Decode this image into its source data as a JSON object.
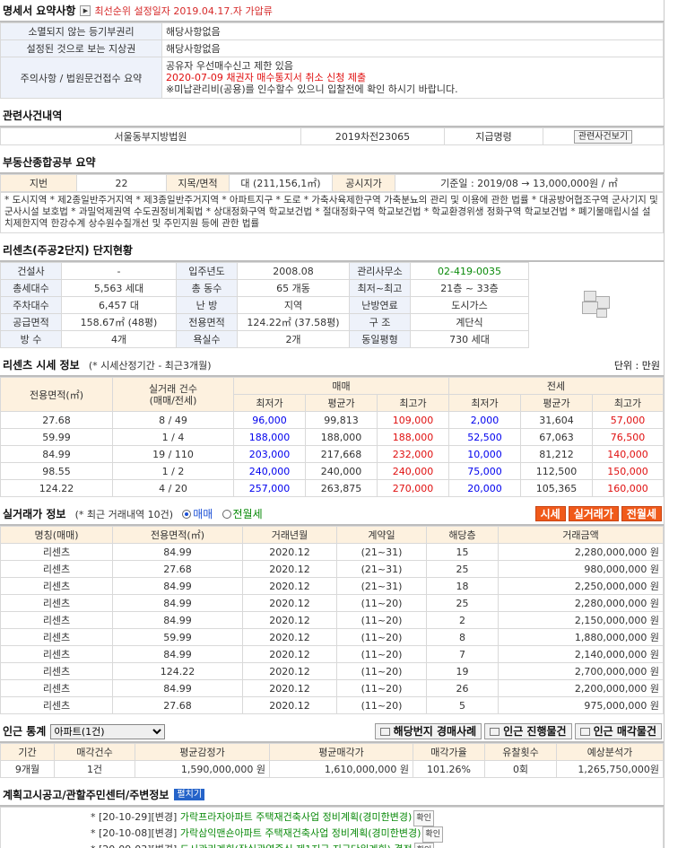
{
  "summary": {
    "title": "명세서 요약사항",
    "note": "최선순위 설정일자 2019.04.17.자 가압류",
    "rows": [
      {
        "label": "소멸되지 않는 등기부권리",
        "value": "해당사항없음"
      },
      {
        "label": "설정된 것으로 보는 지상권",
        "value": "해당사항없음"
      }
    ],
    "caution_label": "주의사항 / 법원문건접수 요약",
    "caution_line1": "공유자 우선매수신고 제한 있음",
    "caution_line2": "2020-07-09 채권자 매수통지서 취소 신청 제출",
    "caution_line3": "※미납관리비(공용)를 인수할수 있으니 입찰전에 확인 하시기 바랍니다."
  },
  "related": {
    "title": "관련사건내역",
    "court": "서울동부지방법원",
    "case_no": "2019차전23065",
    "type": "지급명령",
    "button": "관련사건보기"
  },
  "land": {
    "title": "부동산종합공부 요약",
    "lot_label": "지번",
    "lot_value": "22",
    "area_label": "지목/면적",
    "area_value": "대 (211,156,1㎡)",
    "price_label": "공시지가",
    "price_value": "기준일 : 2019/08 → 13,000,000원 / ㎡",
    "zoning": "* 도시지역 * 제2종일반주거지역 * 제3종일반주거지역 * 아파트지구 * 도로 * 가축사육제한구역 가축분뇨의 관리 및 이용에 관한 법률 * 대공방어협조구역 군사기지 및 군사시설 보호법 * 과밀억제권역 수도권정비계획법 * 상대정화구역 학교보건법 * 절대정화구역 학교보건법 * 학교환경위생 정화구역 학교보건법 * 폐기물매립시설 설치제한지역 한강수계 상수원수질개선 및 주민지원 등에 관한 법률"
  },
  "complex": {
    "title": "리센츠(주공2단지) 단지현황",
    "rows": [
      [
        {
          "l": "건설사",
          "v": "-"
        },
        {
          "l": "입주년도",
          "v": "2008.08"
        },
        {
          "l": "관리사무소",
          "v": "02-419-0035"
        }
      ],
      [
        {
          "l": "총세대수",
          "v": "5,563 세대"
        },
        {
          "l": "총 동수",
          "v": "65 개동"
        },
        {
          "l": "최저~최고",
          "v": "21층 ~ 33층"
        }
      ],
      [
        {
          "l": "주차대수",
          "v": "6,457 대"
        },
        {
          "l": "난 방",
          "v": "지역"
        },
        {
          "l": "난방연료",
          "v": "도시가스"
        }
      ],
      [
        {
          "l": "공급면적",
          "v": "158.67㎡ (48평)"
        },
        {
          "l": "전용면적",
          "v": "124.22㎡ (37.58평)"
        },
        {
          "l": "구 조",
          "v": "계단식"
        }
      ],
      [
        {
          "l": "방 수",
          "v": "4개"
        },
        {
          "l": "욕실수",
          "v": "2개"
        },
        {
          "l": "동일평형",
          "v": "730 세대"
        }
      ]
    ]
  },
  "market": {
    "title": "리센츠 시세 정보",
    "subtitle": "(* 시세산정기간 - 최근3개월)",
    "unit": "단위 : 만원",
    "h_area": "전용면적(㎡)",
    "h_count1": "실거래 건수",
    "h_count2": "(매매/전세)",
    "h_sale": "매매",
    "h_lease": "전세",
    "h_min": "최저가",
    "h_avg": "평균가",
    "h_max": "최고가",
    "rows": [
      [
        "27.68",
        "8 / 49",
        "96,000",
        "99,813",
        "109,000",
        "2,000",
        "31,604",
        "57,000"
      ],
      [
        "59.99",
        "1 / 4",
        "188,000",
        "188,000",
        "188,000",
        "52,500",
        "67,063",
        "76,500"
      ],
      [
        "84.99",
        "19 / 110",
        "203,000",
        "217,668",
        "232,000",
        "10,000",
        "81,212",
        "140,000"
      ],
      [
        "98.55",
        "1 / 2",
        "240,000",
        "240,000",
        "240,000",
        "75,000",
        "112,500",
        "150,000"
      ],
      [
        "124.22",
        "4 / 20",
        "257,000",
        "263,875",
        "270,000",
        "20,000",
        "105,365",
        "160,000"
      ]
    ]
  },
  "deals": {
    "title": "실거래가 정보",
    "subtitle": "(* 최근 거래내역 10건)",
    "radio_sale": "매매",
    "radio_lease": "전월세",
    "btn1": "시세",
    "btn2": "실거래가",
    "btn3": "전월세",
    "headers": [
      "명칭(매매)",
      "전용면적(㎡)",
      "거래년월",
      "계약일",
      "해당층",
      "거래금액"
    ],
    "rows": [
      [
        "리센츠",
        "84.99",
        "2020.12",
        "(21~31)",
        "15",
        "2,280,000,000 원"
      ],
      [
        "리센츠",
        "27.68",
        "2020.12",
        "(21~31)",
        "25",
        "980,000,000 원"
      ],
      [
        "리센츠",
        "84.99",
        "2020.12",
        "(21~31)",
        "18",
        "2,250,000,000 원"
      ],
      [
        "리센츠",
        "84.99",
        "2020.12",
        "(11~20)",
        "25",
        "2,280,000,000 원"
      ],
      [
        "리센츠",
        "84.99",
        "2020.12",
        "(11~20)",
        "2",
        "2,150,000,000 원"
      ],
      [
        "리센츠",
        "59.99",
        "2020.12",
        "(11~20)",
        "8",
        "1,880,000,000 원"
      ],
      [
        "리센츠",
        "84.99",
        "2020.12",
        "(11~20)",
        "7",
        "2,140,000,000 원"
      ],
      [
        "리센츠",
        "124.22",
        "2020.12",
        "(11~20)",
        "19",
        "2,700,000,000 원"
      ],
      [
        "리센츠",
        "84.99",
        "2020.12",
        "(11~20)",
        "26",
        "2,200,000,000 원"
      ],
      [
        "리센츠",
        "27.68",
        "2020.12",
        "(11~20)",
        "5",
        "975,000,000 원"
      ]
    ]
  },
  "nearby": {
    "title": "인근 통계",
    "select_value": "아파트(1건)",
    "btn1": "해당번지 경매사례",
    "btn2": "인근 진행물건",
    "btn3": "인근 매각물건",
    "headers": [
      "기간",
      "매각건수",
      "평균감정가",
      "평균매각가",
      "매각가율",
      "유찰횟수",
      "예상분석가"
    ],
    "row": [
      "9개월",
      "1건",
      "1,590,000,000 원",
      "1,610,000,000 원",
      "101.26%",
      "0회",
      "1,265,750,000원"
    ]
  },
  "plans": {
    "title": "계획고시공고/관할주민센터/주변정보",
    "toggle": "펼치기",
    "check": "확인",
    "items": [
      {
        "tag": "* [20-10-29][변경]",
        "text": "가락프라자아파트 주택재건축사업 정비계획(경미한변경)"
      },
      {
        "tag": "* [20-10-08][변경]",
        "text": "가락삼익맨숀아파트 주택재건축사업 정비계획(경미한변경)"
      },
      {
        "tag": "* [20-09-03][변경]",
        "text": "도시관리계획(잠실광역중심 제1지구 지구단위계획) 결정"
      }
    ]
  }
}
